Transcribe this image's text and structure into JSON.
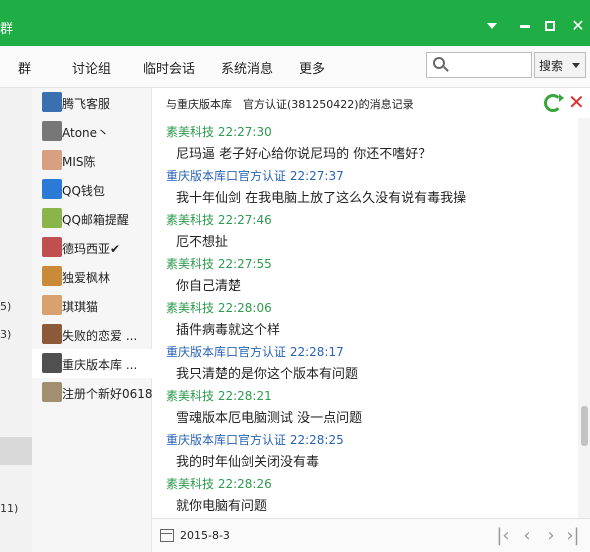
{
  "titlebar": {
    "title_fragment": "群",
    "bg_color": "#1fae46"
  },
  "tabs": [
    {
      "label": "群"
    },
    {
      "label": "讨论组"
    },
    {
      "label": "临时会话"
    },
    {
      "label": "系统消息"
    },
    {
      "label": "更多"
    }
  ],
  "search": {
    "placeholder": "",
    "button_label": "搜索"
  },
  "left_panel": {
    "numbers": [
      "5)",
      "3)",
      "11)"
    ]
  },
  "contacts": [
    {
      "name": "腾飞客服",
      "avatar_color": "#3a6fb0",
      "icon": "tengfei-avatar"
    },
    {
      "name": "Atone丶",
      "avatar_color": "#777777",
      "icon": "person-avatar"
    },
    {
      "name": "MIS陈",
      "avatar_color": "#d8a080",
      "icon": "cartoon-avatar"
    },
    {
      "name": "QQ钱包",
      "avatar_color": "#2b7ad6",
      "icon": "penguin-avatar"
    },
    {
      "name": "QQ邮箱提醒",
      "avatar_color": "#8ab54a",
      "icon": "mail-avatar"
    },
    {
      "name": "德玛西亚✔",
      "avatar_color": "#c05050",
      "icon": "game-avatar"
    },
    {
      "name": "独爱枫林",
      "avatar_color": "#c98a3a",
      "icon": "landscape-avatar"
    },
    {
      "name": "琪琪猫",
      "avatar_color": "#d9a070",
      "icon": "cat-avatar"
    },
    {
      "name": "失败的恋爱 ...",
      "avatar_color": "#8a5a3a",
      "icon": "face-avatar"
    },
    {
      "name": "重庆版本库 ...",
      "avatar_color": "#505050",
      "icon": "group-avatar"
    },
    {
      "name": "注册个新好0618",
      "avatar_color": "#a09070",
      "icon": "note-avatar"
    }
  ],
  "chat": {
    "title": "与重庆版本库　官方认证(381250422)的消息记录"
  },
  "messages": [
    {
      "sender": "素美科技",
      "time": "22:27:30",
      "color": "green",
      "text": "尼玛逼 老子好心给你说尼玛的 你还不嗜好？"
    },
    {
      "sender": "重庆版本库口官方认证",
      "time": "22:27:37",
      "color": "blue",
      "text": "我十年仙剑 在我电脑上放了这么久没有说有毒我操"
    },
    {
      "sender": "素美科技",
      "time": "22:27:46",
      "color": "green",
      "text": "厄不想扯"
    },
    {
      "sender": "素美科技",
      "time": "22:27:55",
      "color": "green",
      "text": "你自己清楚"
    },
    {
      "sender": "素美科技",
      "time": "22:28:06",
      "color": "green",
      "text": "插件病毒就这个样"
    },
    {
      "sender": "重庆版本库口官方认证",
      "time": "22:28:17",
      "color": "blue",
      "text": "我只清楚的是你这个版本有问题"
    },
    {
      "sender": "素美科技",
      "time": "22:28:21",
      "color": "green",
      "text": "雪魂版本厄电脑测试 没一点问题"
    },
    {
      "sender": "重庆版本库口官方认证",
      "time": "22:28:25",
      "color": "blue",
      "text": "我的时年仙剑关闭没有毒"
    },
    {
      "sender": "素美科技",
      "time": "22:28:26",
      "color": "green",
      "text": "就你电脑有问题"
    }
  ],
  "footer": {
    "date": "2015-8-3"
  }
}
